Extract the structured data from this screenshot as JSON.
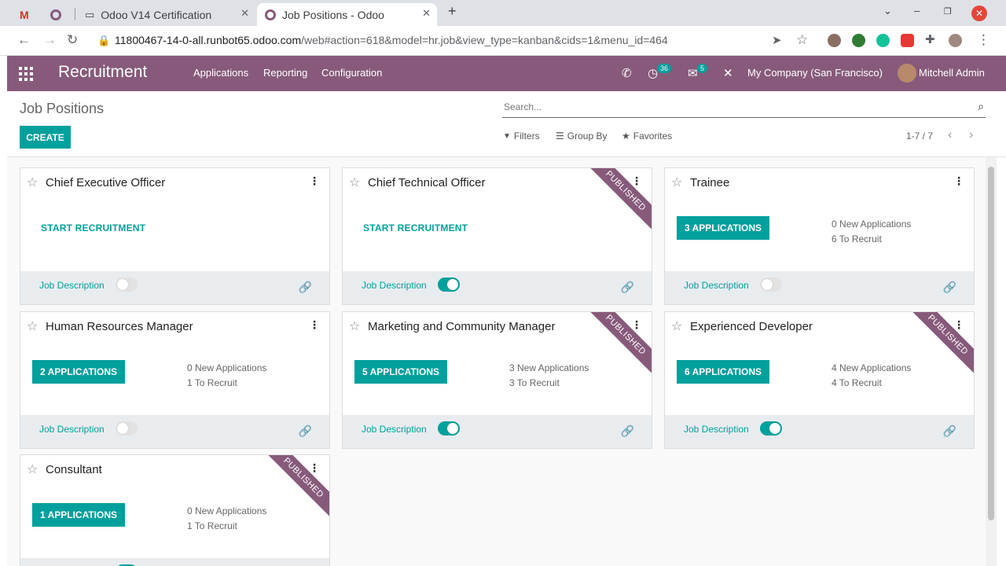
{
  "browser": {
    "tabs": [
      {
        "label": ""
      },
      {
        "label": ""
      },
      {
        "label": "Odoo V14 Certification"
      },
      {
        "label": "Job Positions - Odoo"
      }
    ],
    "url_host": "11800467-14-0-all.runbot65.odoo.com",
    "url_path": "/web#action=618&model=hr.job&view_type=kanban&cids=1&menu_id=464"
  },
  "navbar": {
    "brand": "Recruitment",
    "menu": [
      "Applications",
      "Reporting",
      "Configuration"
    ],
    "activity_count": "36",
    "message_count": "5",
    "company": "My Company (San Francisco)",
    "user": "Mitchell Admin",
    "color": "#875a7b"
  },
  "control": {
    "title": "Job Positions",
    "create_label": "CREATE",
    "search_placeholder": "Search...",
    "filters": "Filters",
    "group_by": "Group By",
    "favorites": "Favorites",
    "pager": "1-7 / 7"
  },
  "accent": "#00a09d",
  "jobs": [
    {
      "title": "Chief Executive Officer",
      "action": "START RECRUITMENT",
      "new": "",
      "to_recruit": "",
      "published": false,
      "desc_on": false
    },
    {
      "title": "Chief Technical Officer",
      "action": "START RECRUITMENT",
      "new": "",
      "to_recruit": "",
      "published": true,
      "desc_on": true
    },
    {
      "title": "Trainee",
      "action": "3 APPLICATIONS",
      "new": "0 New Applications",
      "to_recruit": "6 To Recruit",
      "published": false,
      "desc_on": false
    },
    {
      "title": "Human Resources Manager",
      "action": "2 APPLICATIONS",
      "new": "0 New Applications",
      "to_recruit": "1 To Recruit",
      "published": false,
      "desc_on": false
    },
    {
      "title": "Marketing and Community Manager",
      "action": "5 APPLICATIONS",
      "new": "3 New Applications",
      "to_recruit": "3 To Recruit",
      "published": true,
      "desc_on": true
    },
    {
      "title": "Experienced Developer",
      "action": "6 APPLICATIONS",
      "new": "4 New Applications",
      "to_recruit": "4 To Recruit",
      "published": true,
      "desc_on": true
    },
    {
      "title": "Consultant",
      "action": "1 APPLICATIONS",
      "new": "0 New Applications",
      "to_recruit": "1 To Recruit",
      "published": true,
      "desc_on": true
    }
  ],
  "labels": {
    "job_description": "Job Description",
    "published": "PUBLISHED"
  }
}
